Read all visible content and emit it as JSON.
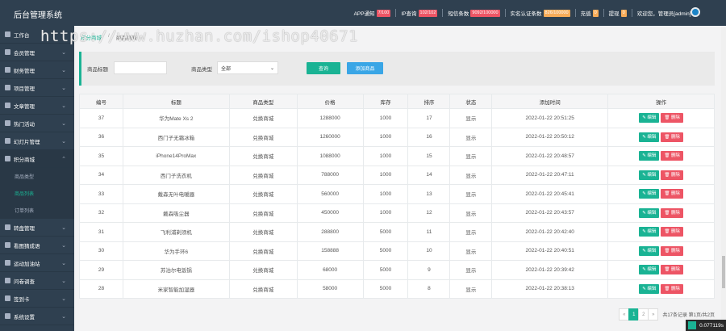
{
  "app": {
    "title": "后台管理系统"
  },
  "header": {
    "stats": [
      {
        "label": "APP通知",
        "value": "7/100",
        "badge_color": "#ed5565"
      },
      {
        "label": "IP查询",
        "value": "102/102",
        "badge_color": "#ed5565"
      },
      {
        "label": "短信条数",
        "value": "9092/100000",
        "badge_color": "#ed5565"
      },
      {
        "label": "实名认证条数",
        "value": "826/100000",
        "badge_color": "#f8ac59"
      },
      {
        "label": "充值",
        "value": "0",
        "badge_color": "#f8ac59"
      },
      {
        "label": "提现",
        "value": "0",
        "badge_color": "#f8ac59"
      }
    ],
    "user": "欢迎您，管理员[admin]"
  },
  "sidebar": {
    "items": [
      {
        "label": "工作台",
        "icon": "dashboard-icon",
        "chevron": ""
      },
      {
        "label": "会员管理",
        "icon": "user-icon",
        "chevron": "⌄"
      },
      {
        "label": "财务管理",
        "icon": "finance-icon",
        "chevron": "⌄"
      },
      {
        "label": "项目管理",
        "icon": "project-icon",
        "chevron": "⌄"
      },
      {
        "label": "文章管理",
        "icon": "article-icon",
        "chevron": "⌄"
      },
      {
        "label": "热门活动",
        "icon": "activity-icon",
        "chevron": "⌄"
      },
      {
        "label": "幻灯片管理",
        "icon": "slide-icon",
        "chevron": "⌄"
      },
      {
        "label": "积分商城",
        "icon": "mall-icon",
        "chevron": "⌃"
      }
    ],
    "sub_items": [
      {
        "label": "商品类型"
      },
      {
        "label": "商品列表"
      },
      {
        "label": "订单列表"
      }
    ],
    "items_after": [
      {
        "label": "转盘管理",
        "icon": "wheel-icon",
        "chevron": "⌄"
      },
      {
        "label": "看图猜成语",
        "icon": "puzzle-icon",
        "chevron": "⌄"
      },
      {
        "label": "运动加油站",
        "icon": "sport-icon",
        "chevron": "⌄"
      },
      {
        "label": "问卷调查",
        "icon": "survey-icon",
        "chevron": "⌄"
      },
      {
        "label": "签到卡",
        "icon": "card-icon",
        "chevron": "⌄"
      },
      {
        "label": "系统设置",
        "icon": "gear-icon",
        "chevron": "⌄"
      },
      {
        "label": "安装包管理",
        "icon": "package-icon",
        "chevron": "⌄"
      }
    ]
  },
  "breadcrumb": {
    "home": "积分商城",
    "sep": "/",
    "current": "商品列表"
  },
  "watermark": "https://www.huzhan.com/ishop40671",
  "filter": {
    "title_label": "商品标题",
    "title_value": "",
    "type_label": "商品类型",
    "type_value": "全部",
    "search_button": "查询",
    "add_button": "添加商品"
  },
  "table": {
    "columns": [
      "编号",
      "标题",
      "商品类型",
      "价格",
      "库存",
      "排序",
      "状态",
      "添加时间",
      "操作"
    ],
    "rows": [
      [
        "37",
        "华为Mate Xs 2",
        "兑换商城",
        "1288000",
        "1000",
        "17",
        "显示",
        "2022-01-22 20:51:25"
      ],
      [
        "36",
        "西门子无霜冰箱",
        "兑换商城",
        "1260000",
        "1000",
        "16",
        "显示",
        "2022-01-22 20:50:12"
      ],
      [
        "35",
        "iPhone14ProMax",
        "兑换商城",
        "1088000",
        "1000",
        "15",
        "显示",
        "2022-01-22 20:48:57"
      ],
      [
        "34",
        "西门子洗衣机",
        "兑换商城",
        "788000",
        "1000",
        "14",
        "显示",
        "2022-01-22 20:47:11"
      ],
      [
        "33",
        "戴森无叶电暖器",
        "兑换商城",
        "560000",
        "1000",
        "13",
        "显示",
        "2022-01-22 20:45:41"
      ],
      [
        "32",
        "戴森吸尘器",
        "兑换商城",
        "450000",
        "1000",
        "12",
        "显示",
        "2022-01-22 20:43:57"
      ],
      [
        "31",
        "飞利浦剃须机",
        "兑换商城",
        "288800",
        "5000",
        "11",
        "显示",
        "2022-01-22 20:42:40"
      ],
      [
        "30",
        "华为手环6",
        "兑换商城",
        "158888",
        "5000",
        "10",
        "显示",
        "2022-01-22 20:40:51"
      ],
      [
        "29",
        "苏泊尔电饭锅",
        "兑换商城",
        "68000",
        "5000",
        "9",
        "显示",
        "2022-01-22 20:39:42"
      ],
      [
        "28",
        "米家智能加湿器",
        "兑换商城",
        "58000",
        "5000",
        "8",
        "显示",
        "2022-01-22 20:38:13"
      ]
    ],
    "edit_label": "编辑",
    "delete_label": "删除"
  },
  "pager": {
    "prev": "«",
    "pages": [
      "1",
      "2"
    ],
    "next": "»",
    "total": "共17条记录 第1页/共2页"
  },
  "speed": {
    "value": "0.077119s"
  }
}
